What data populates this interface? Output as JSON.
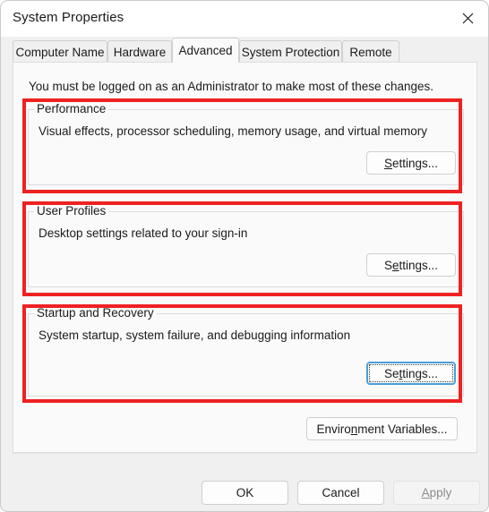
{
  "window": {
    "title": "System Properties",
    "close_icon": "close-icon"
  },
  "tabs": [
    {
      "label": "Computer Name",
      "selected": false
    },
    {
      "label": "Hardware",
      "selected": false
    },
    {
      "label": "Advanced",
      "selected": true
    },
    {
      "label": "System Protection",
      "selected": false
    },
    {
      "label": "Remote",
      "selected": false
    }
  ],
  "panel": {
    "admin_note": "You must be logged on as an Administrator to make most of these changes.",
    "groups": [
      {
        "legend": "Performance",
        "description": "Visual effects, processor scheduling, memory usage, and virtual memory",
        "button": {
          "label_before": "",
          "accel": "S",
          "label_after": "ettings...",
          "focused": false
        }
      },
      {
        "legend": "User Profiles",
        "description": "Desktop settings related to your sign-in",
        "button": {
          "label_before": "S",
          "accel": "e",
          "label_after": "ttings...",
          "focused": false
        }
      },
      {
        "legend": "Startup and Recovery",
        "description": "System startup, system failure, and debugging information",
        "button": {
          "label_before": "Se",
          "accel": "t",
          "label_after": "tings...",
          "focused": true
        }
      }
    ],
    "environment_button": {
      "label_before": "Enviro",
      "accel": "n",
      "label_after": "ment Variables..."
    }
  },
  "footer": {
    "ok": {
      "label_before": "OK",
      "accel": "",
      "label_after": "",
      "disabled": false
    },
    "cancel": {
      "label_before": "Cancel",
      "accel": "",
      "label_after": "",
      "disabled": false
    },
    "apply": {
      "label_before": "",
      "accel": "A",
      "label_after": "pply",
      "disabled": true
    }
  },
  "colors": {
    "annotation_red": "#ee2222",
    "focus_blue": "#4a9edb",
    "window_bg": "#f0f0f0",
    "panel_bg": "#fafafa"
  }
}
